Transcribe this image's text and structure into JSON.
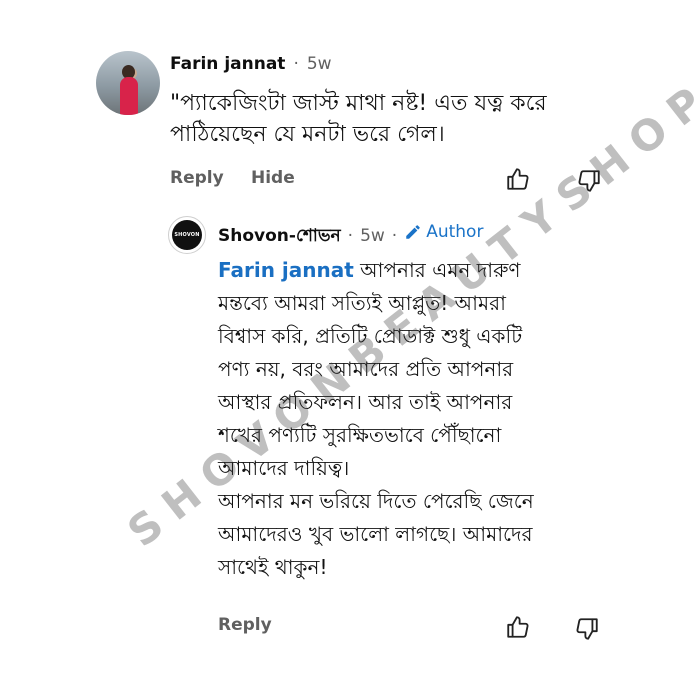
{
  "comment": {
    "author": "Farin jannat",
    "time": "5w",
    "text_line1": "\"প্যাকেজিংটা জাস্ট মাথা নষ্ট! এত যত্ন করে",
    "text_line2": "পাঠিয়েছেন যে মনটা ভরে গেল।",
    "reply_label": "Reply",
    "hide_label": "Hide"
  },
  "reply": {
    "author": "Shovon-শোভন",
    "time": "5w",
    "author_badge": "Author",
    "avatar_text": "SHOVON",
    "mention": "Farin jannat",
    "line1": " আপনার এমন দারুণ",
    "line2": "মন্তব্যে আমরা সত্যিই আপ্লুত! আমরা",
    "line3": "বিশ্বাস করি, প্রতিটি প্রোডাক্ট শুধু একটি",
    "line4": "পণ্য নয়, বরং আমাদের প্রতি আপনার",
    "line5": "আস্থার প্রতিফলন। আর তাই আপনার",
    "line6": "শখের পণ্যটি সুরক্ষিতভাবে পৌঁছানো",
    "line7": "আমাদের দায়িত্ব।",
    "line8": "আপনার মন ভরিয়ে দিতে পেরেছি জেনে",
    "line9": "আমাদেরও খুব ভালো লাগছে। আমাদের",
    "line10": "সাথেই থাকুন!",
    "reply_label": "Reply"
  },
  "watermark": "SHOVONBEAUTYSHOP",
  "icons": {
    "like": "thumbs-up-icon",
    "dislike": "thumbs-down-icon",
    "author": "pencil-icon"
  },
  "colors": {
    "mention": "#1a6fc2",
    "author_badge": "#1a73c8",
    "meta": "#606060"
  }
}
